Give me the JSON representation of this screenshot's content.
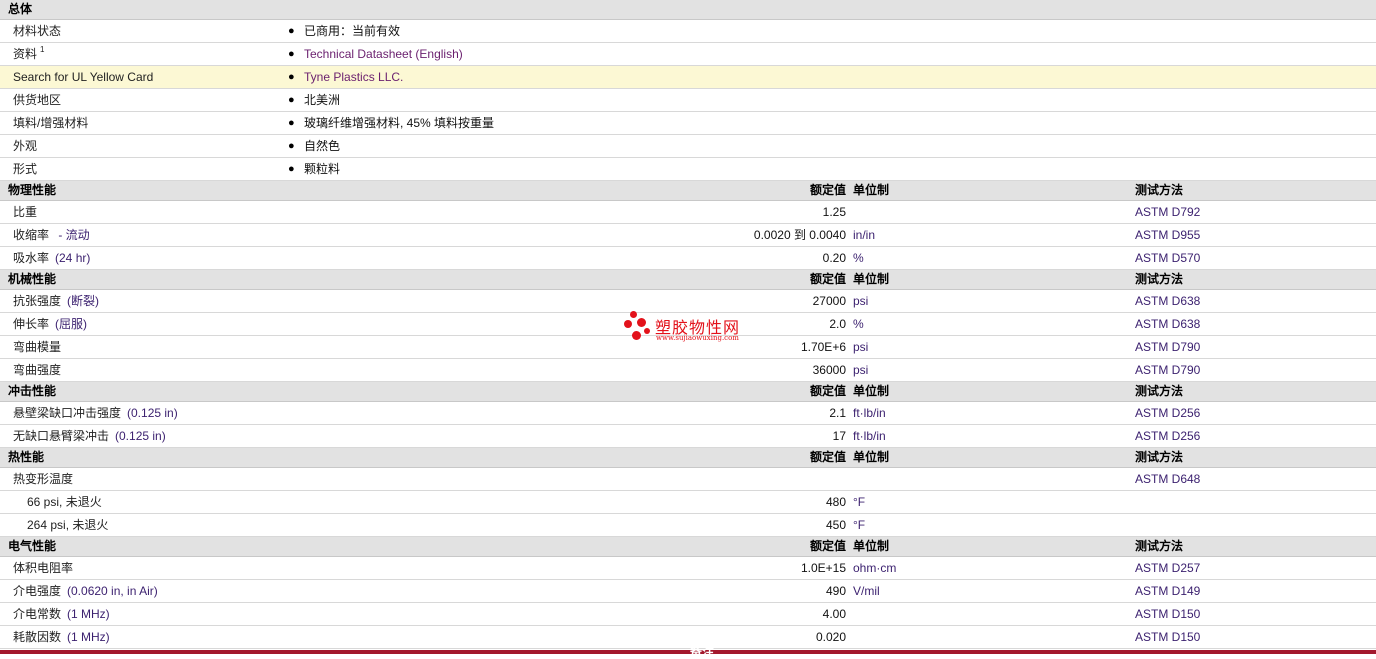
{
  "general": {
    "title": "总体",
    "rows": [
      {
        "label": "材料状态",
        "sup": "",
        "value": "已商用：当前有效",
        "link": false,
        "highlight": false
      },
      {
        "label": "资料",
        "sup": "1",
        "value": "Technical Datasheet (English)",
        "link": true,
        "highlight": false
      },
      {
        "label": "Search for UL Yellow Card",
        "sup": "",
        "value": "Tyne Plastics LLC.",
        "link": true,
        "highlight": true
      },
      {
        "label": "供货地区",
        "sup": "",
        "value": "北美洲",
        "link": false,
        "highlight": false
      },
      {
        "label": "填料/增强材料",
        "sup": "",
        "value": "玻璃纤维增强材料, 45% 填料按重量",
        "link": false,
        "highlight": false
      },
      {
        "label": "外观",
        "sup": "",
        "value": "自然色",
        "link": false,
        "highlight": false
      },
      {
        "label": "形式",
        "sup": "",
        "value": "颗粒料",
        "link": false,
        "highlight": false
      }
    ]
  },
  "column_headers": {
    "rated": "额定值",
    "unit": "单位制",
    "test": "测试方法"
  },
  "sections": [
    {
      "title": "物理性能",
      "rows": [
        {
          "label": "比重",
          "cond": "",
          "rated": "1.25",
          "unit": "",
          "test": "ASTM D792"
        },
        {
          "label": "收缩率",
          "cond": " - 流动",
          "rated": "0.0020 到 0.0040",
          "unit": "in/in",
          "test": "ASTM D955"
        },
        {
          "label": "吸水率",
          "cond": "(24 hr)",
          "rated": "0.20",
          "unit": "%",
          "test": "ASTM D570"
        }
      ]
    },
    {
      "title": "机械性能",
      "rows": [
        {
          "label": "抗张强度",
          "cond": "(断裂)",
          "rated": "27000",
          "unit": "psi",
          "test": "ASTM D638"
        },
        {
          "label": "伸长率",
          "cond": "(屈服)",
          "rated": "2.0",
          "unit": "%",
          "test": "ASTM D638"
        },
        {
          "label": "弯曲模量",
          "cond": "",
          "rated": "1.70E+6",
          "unit": "psi",
          "test": "ASTM D790"
        },
        {
          "label": "弯曲强度",
          "cond": "",
          "rated": "36000",
          "unit": "psi",
          "test": "ASTM D790"
        }
      ]
    },
    {
      "title": "冲击性能",
      "rows": [
        {
          "label": "悬壁梁缺口冲击强度",
          "cond": "(0.125 in)",
          "rated": "2.1",
          "unit": "ft·lb/in",
          "test": "ASTM D256"
        },
        {
          "label": "无缺口悬臂梁冲击",
          "cond": "(0.125 in)",
          "rated": "17",
          "unit": "ft·lb/in",
          "test": "ASTM D256"
        }
      ]
    },
    {
      "title": "热性能",
      "rows": [
        {
          "label": "热变形温度",
          "cond": "",
          "rated": "",
          "unit": "",
          "test": "ASTM D648"
        },
        {
          "label": "66 psi, 未退火",
          "cond": "",
          "rated": "480",
          "unit": "°F",
          "test": "",
          "sub": true
        },
        {
          "label": "264 psi, 未退火",
          "cond": "",
          "rated": "450",
          "unit": "°F",
          "test": "",
          "sub": true
        }
      ]
    },
    {
      "title": "电气性能",
      "rows": [
        {
          "label": "体积电阻率",
          "cond": "",
          "rated": "1.0E+15",
          "unit": "ohm·cm",
          "test": "ASTM D257"
        },
        {
          "label": "介电强度",
          "cond": "(0.0620 in, in Air)",
          "rated": "490",
          "unit": "V/mil",
          "test": "ASTM D149"
        },
        {
          "label": "介电常数",
          "cond": "(1 MHz)",
          "rated": "4.00",
          "unit": "",
          "test": "ASTM D150"
        },
        {
          "label": "耗散因数",
          "cond": "(1 MHz)",
          "rated": "0.020",
          "unit": "",
          "test": "ASTM D150"
        }
      ]
    }
  ],
  "bullet_symbol": "●",
  "footer": {
    "text": "备注",
    "color": "#a3182d"
  },
  "watermark": {
    "title": "塑胶物性网",
    "url": "www.sujiaowuxing.com",
    "color": "#e3121b"
  }
}
